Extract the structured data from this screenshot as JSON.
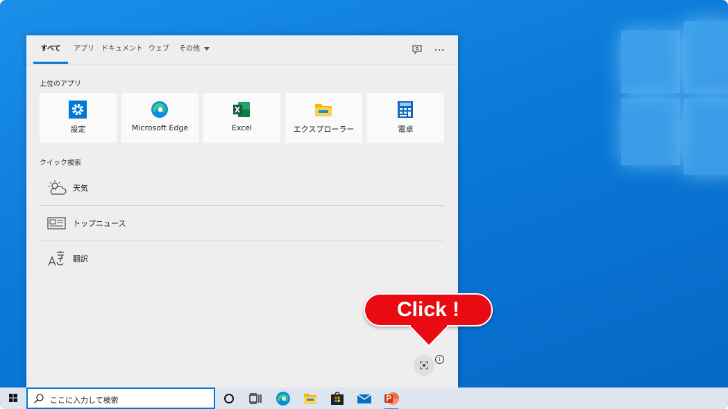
{
  "tabs": [
    {
      "label": "すべて"
    },
    {
      "label": "アプリ"
    },
    {
      "label": "ドキュメント"
    },
    {
      "label": "ウェブ"
    },
    {
      "label": "その他"
    }
  ],
  "top_apps": {
    "title": "上位のアプリ",
    "items": [
      {
        "label": "設定",
        "icon": "settings-gear-icon"
      },
      {
        "label": "Microsoft Edge",
        "icon": "edge-icon"
      },
      {
        "label": "Excel",
        "icon": "excel-icon"
      },
      {
        "label": "エクスプローラー",
        "icon": "folder-icon"
      },
      {
        "label": "電卓",
        "icon": "calculator-icon"
      }
    ]
  },
  "quick_search": {
    "title": "クイック検索",
    "items": [
      {
        "label": "天気",
        "icon": "weather-icon"
      },
      {
        "label": "トップニュース",
        "icon": "news-icon"
      },
      {
        "label": "翻訳",
        "icon": "translate-icon"
      }
    ]
  },
  "callout": {
    "text": "Click !"
  },
  "info_glyph": "i",
  "taskbar": {
    "search_text": "ここに入力して検索",
    "accent": "#0078d4"
  },
  "colors": {
    "callout": "#ea0b12",
    "desktop": "#0a79d8"
  }
}
